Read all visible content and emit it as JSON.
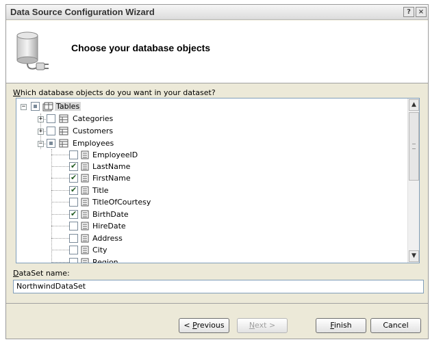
{
  "window": {
    "title": "Data Source Configuration Wizard",
    "help_glyph": "?",
    "close_glyph": "×"
  },
  "header": {
    "title": "Choose your database objects",
    "icon": "database-plug-icon"
  },
  "prompt": {
    "accel": "W",
    "rest": "hich database objects do you want in your dataset?"
  },
  "tree": {
    "root": {
      "label": "Tables",
      "state": "partial",
      "expanded": true
    },
    "tables": [
      {
        "label": "Categories",
        "state": "unchecked",
        "expanded": false
      },
      {
        "label": "Customers",
        "state": "unchecked",
        "expanded": false
      },
      {
        "label": "Employees",
        "state": "partial",
        "expanded": true
      }
    ],
    "columns": [
      {
        "label": "EmployeeID",
        "checked": false
      },
      {
        "label": "LastName",
        "checked": true
      },
      {
        "label": "FirstName",
        "checked": true
      },
      {
        "label": "Title",
        "checked": true
      },
      {
        "label": "TitleOfCourtesy",
        "checked": false
      },
      {
        "label": "BirthDate",
        "checked": true
      },
      {
        "label": "HireDate",
        "checked": false
      },
      {
        "label": "Address",
        "checked": false
      },
      {
        "label": "City",
        "checked": false
      },
      {
        "label": "Region",
        "checked": false
      }
    ]
  },
  "dataset": {
    "label_accel": "D",
    "label_rest": "ataSet name:",
    "value": "NorthwindDataSet"
  },
  "buttons": {
    "previous": {
      "pre": "< ",
      "accel": "P",
      "rest": "revious"
    },
    "next": {
      "accel": "N",
      "rest": "ext >"
    },
    "finish": {
      "accel": "F",
      "rest": "inish"
    },
    "cancel": "Cancel"
  }
}
